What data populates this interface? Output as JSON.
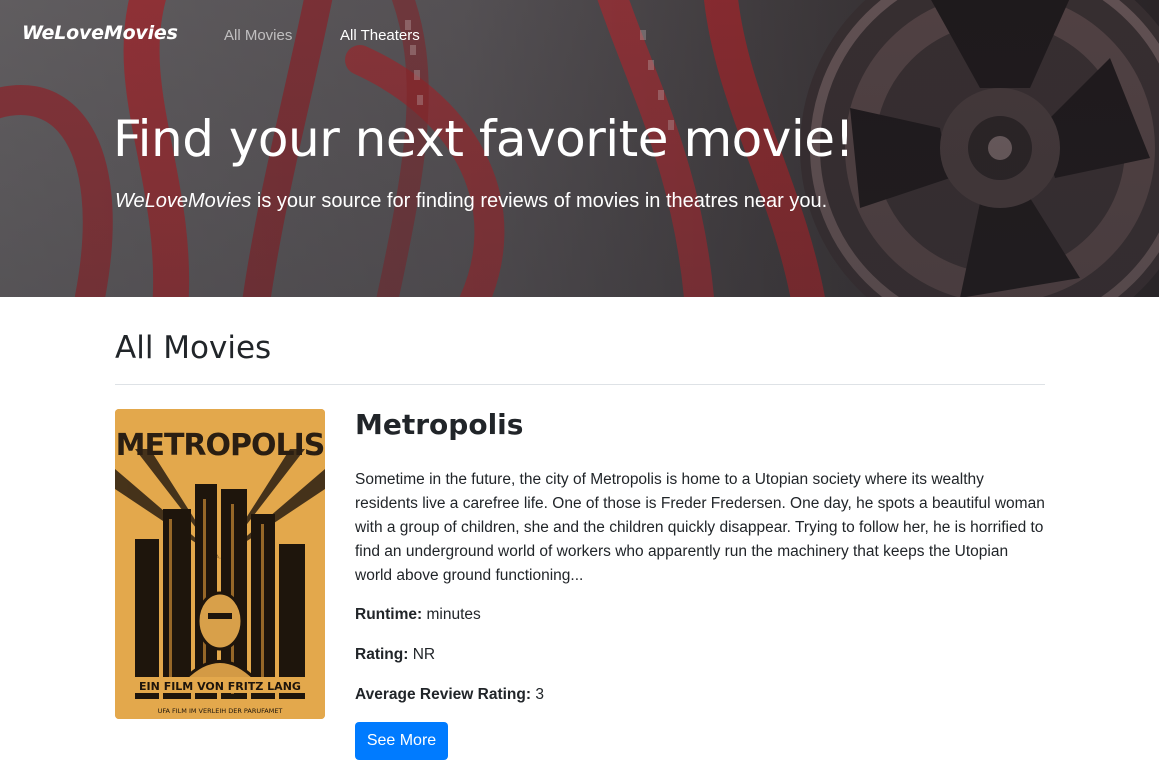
{
  "colors": {
    "accent": "#007bff",
    "hero_text": "#ffffff",
    "film_red": "#b8262c",
    "poster_gold": "#e2a54a"
  },
  "navbar": {
    "brand": "WeLoveMovies",
    "links": [
      {
        "label": "All Movies",
        "icon": ""
      },
      {
        "label": "All Theaters",
        "icon": ""
      }
    ]
  },
  "hero": {
    "background_image": "film-reel-image",
    "title": "Find your next favorite movie!",
    "lead_brand": "WeLoveMovies",
    "lead_rest": " is your source for finding reviews of movies in theatres near you."
  },
  "main": {
    "section_title": "All Movies",
    "movies": [
      {
        "title": "Metropolis",
        "poster_image": "metropolis-poster-image",
        "poster_text": {
          "title": "METROPOLIS",
          "credits": "EIN FILM VON FRITZ LANG",
          "footer": "UFA FILM IM VERLEIH DER PARUFAMET"
        },
        "description": "Sometime in the future, the city of Metropolis is home to a Utopian society where its wealthy residents live a carefree life. One of those is Freder Fredersen. One day, he spots a beautiful woman with a group of children, she and the children quickly disappear. Trying to follow her, he is horrified to find an underground world of workers who apparently run the machinery that keeps the Utopian world above ground functioning...",
        "runtime_label": "Runtime:",
        "runtime_value": " minutes",
        "rating_label": "Rating:",
        "rating_value": "NR",
        "avg_label": "Average Review Rating:",
        "avg_value": "3",
        "button_label": "See More"
      }
    ]
  }
}
